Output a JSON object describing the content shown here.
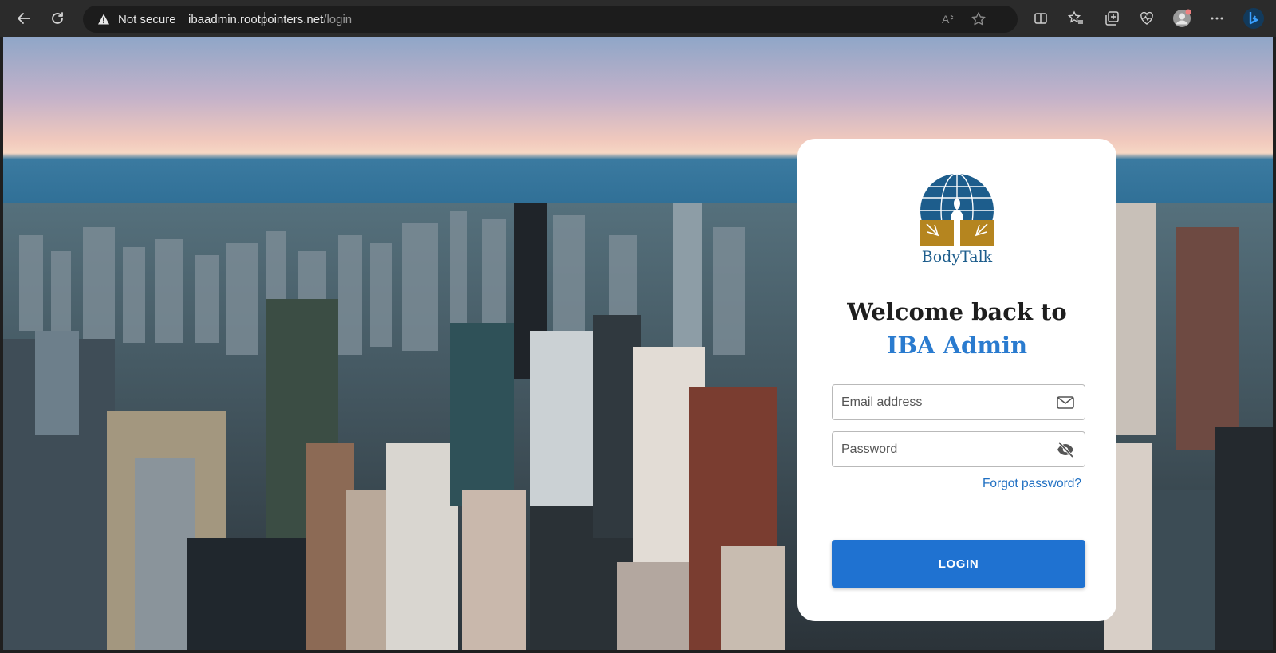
{
  "browser": {
    "security_label": "Not secure",
    "url_host": "ibaadmin.rootpointers.net",
    "url_path": "/login",
    "icons": [
      "back-icon",
      "refresh-icon",
      "warning-icon",
      "read-aloud-icon",
      "favorite-star-icon",
      "split-screen-icon",
      "favorites-icon",
      "collections-icon",
      "heart-pulse-icon",
      "profile-icon",
      "more-icon",
      "bing-icon"
    ]
  },
  "login": {
    "logo_text": "BodyTalk",
    "welcome_text": "Welcome back to",
    "app_name": "IBA Admin",
    "email_placeholder": "Email address",
    "password_placeholder": "Password",
    "forgot_password": "Forgot password?",
    "login_button": "LOGIN",
    "accent_color": "#2a7bcf",
    "button_color": "#1f72d1"
  }
}
